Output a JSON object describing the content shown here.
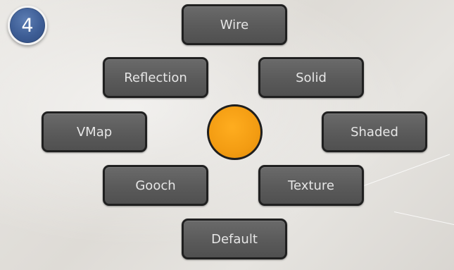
{
  "badge": {
    "number": "4"
  },
  "pie_menu": {
    "top": {
      "label": "Wire"
    },
    "upper_left": {
      "label": "Reflection"
    },
    "upper_right": {
      "label": "Solid"
    },
    "left": {
      "label": "VMap"
    },
    "right": {
      "label": "Shaded"
    },
    "lower_left": {
      "label": "Gooch"
    },
    "lower_right": {
      "label": "Texture"
    },
    "bottom": {
      "label": "Default"
    }
  },
  "colors": {
    "center_dot": "#f39c12",
    "button_fill": "#5e5e5e",
    "badge_fill": "#3d5d95"
  }
}
